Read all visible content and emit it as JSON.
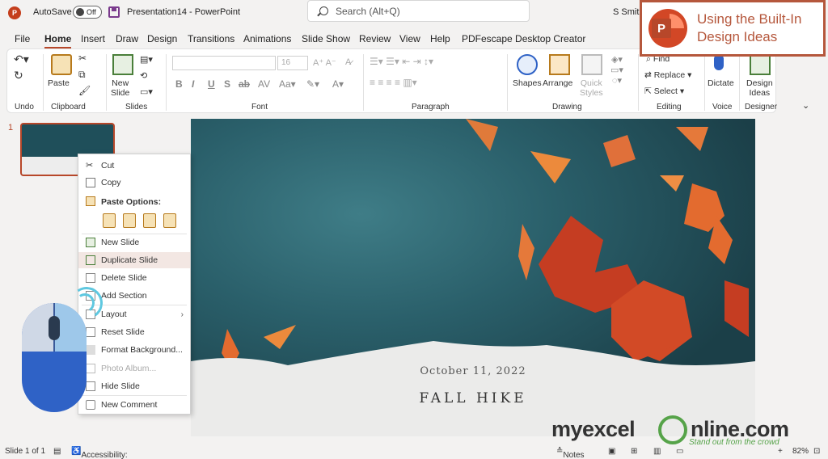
{
  "titlebar": {
    "autosave_label": "AutoSave",
    "autosave_state": "Off",
    "doc_title": "Presentation14  -  PowerPoint",
    "search_placeholder": "Search (Alt+Q)",
    "user_name": "S Smith"
  },
  "callout": {
    "text_line1": "Using the Built-In",
    "text_line2": "Design Ideas"
  },
  "menu": {
    "tabs": [
      "File",
      "Home",
      "Insert",
      "Draw",
      "Design",
      "Transitions",
      "Animations",
      "Slide Show",
      "Review",
      "View",
      "Help",
      "PDFescape Desktop Creator"
    ],
    "active_tab": "Home"
  },
  "ribbon": {
    "groups": {
      "undo": "Undo",
      "clipboard": "Clipboard",
      "slides": "Slides",
      "font": "Font",
      "paragraph": "Paragraph",
      "drawing": "Drawing",
      "editing": "Editing",
      "voice": "Voice",
      "designer": "Designer"
    },
    "buttons": {
      "paste": "Paste",
      "new_slide_line1": "New",
      "new_slide_line2": "Slide",
      "shapes": "Shapes",
      "arrange": "Arrange",
      "quick_styles_line1": "Quick",
      "quick_styles_line2": "Styles",
      "find": "Find",
      "replace": "Replace",
      "select": "Select",
      "dictate": "Dictate",
      "design_ideas_line1": "Design",
      "design_ideas_line2": "Ideas"
    },
    "font_size": "16"
  },
  "thumbnails": {
    "slide_number": "1"
  },
  "slide": {
    "date": "October 11, 2022",
    "title": "FALL HIKE"
  },
  "context_menu": {
    "cut": "Cut",
    "copy": "Copy",
    "paste_options": "Paste Options:",
    "new_slide": "New Slide",
    "duplicate_slide": "Duplicate Slide",
    "delete_slide": "Delete Slide",
    "add_section": "Add Section",
    "layout": "Layout",
    "reset_slide": "Reset Slide",
    "format_background": "Format Background...",
    "photo_album": "Photo Album...",
    "hide_slide": "Hide Slide",
    "new_comment": "New Comment"
  },
  "statusbar": {
    "slide_count": "Slide 1 of 1",
    "accessibility": "Accessibility: Good to go",
    "notes": "Notes",
    "zoom": "82%"
  },
  "watermark": {
    "brand_left": "myexcel",
    "brand_right": "nline.com",
    "tagline": "Stand out from the crowd"
  },
  "colors": {
    "accent": "#b7472a",
    "callout_border": "#b5573c",
    "slide_bg": "#1f4a55"
  }
}
